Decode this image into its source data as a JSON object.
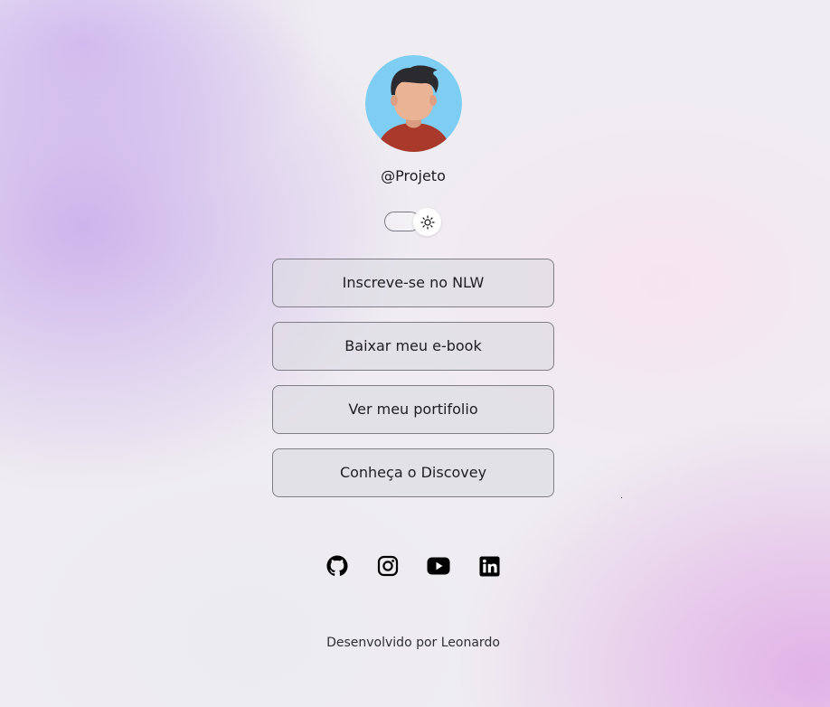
{
  "profile": {
    "avatar_alt": "Avatar",
    "handle": "@Projeto"
  },
  "theme_toggle": {
    "icon": "sun-icon",
    "mode": "light"
  },
  "links": [
    {
      "label": "Inscreve-se no NLW"
    },
    {
      "label": "Baixar meu e-book"
    },
    {
      "label": "Ver meu portifolio"
    },
    {
      "label": "Conheça o Discovey"
    }
  ],
  "social": [
    {
      "icon": "github-icon"
    },
    {
      "icon": "instagram-icon"
    },
    {
      "icon": "youtube-icon"
    },
    {
      "icon": "linkedin-icon"
    }
  ],
  "footer": {
    "text": "Desenvolvido por Leonardo"
  },
  "colors": {
    "button_border": "#7f7d86",
    "button_bg": "#dcdae2",
    "accent_purple": "#c8aaeb",
    "accent_pink": "#e1afe6"
  }
}
